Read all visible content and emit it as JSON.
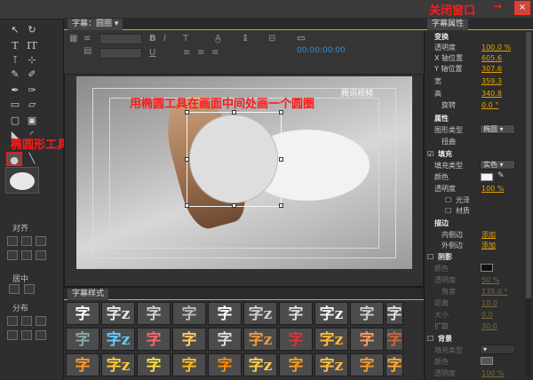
{
  "title_tab": "字幕：圆圈",
  "style_tab": "字幕样式",
  "props_tab": "字幕属性",
  "timecode": "00:00:00:00",
  "annotations": {
    "close_window": "关闭窗口",
    "ellipse_tool": "椭圆形工具",
    "instruction": "用椭圆工具在画面中间处画一个圆圈"
  },
  "left_sections": {
    "align": "对齐",
    "center": "居中",
    "distribute": "分布"
  },
  "logo_text": "腾讯视频",
  "props": {
    "transform": "变换",
    "opacity_label": "透明度",
    "opacity_value": "100.0 %",
    "x_label": "X 轴位置",
    "x_value": "605.6",
    "y_label": "Y 轴位置",
    "y_value": "307.6",
    "width_label": "宽",
    "width_value": "359.3",
    "height_label": "高",
    "height_value": "340.8",
    "rotation_label": "旋转",
    "rotation_value": "0.0 °",
    "attributes": "属性",
    "shape_type_label": "图形类型",
    "shape_type_value": "椭圆",
    "distort_label": "扭曲",
    "fill": "填充",
    "fill_type_label": "填充类型",
    "fill_type_value": "实色",
    "color_label": "颜色",
    "fill_opacity_label": "透明度",
    "fill_opacity_value": "100 %",
    "sheen_label": "光泽",
    "texture_label": "材质",
    "stroke": "描边",
    "inner_stroke_label": "内侧边",
    "inner_stroke_add": "添加",
    "outer_stroke_label": "外侧边",
    "outer_stroke_add": "添加",
    "shadow": "阴影",
    "shadow_color_label": "颜色",
    "shadow_opacity_label": "透明度",
    "shadow_opacity_value": "50 %",
    "angle_label": "角度",
    "angle_value": "135.0 °",
    "distance_label": "距离",
    "distance_value": "10.0",
    "size_label": "大小",
    "size_value": "0.0",
    "spread_label": "扩散",
    "spread_value": "30.0",
    "background": "背景",
    "bg_fill_type_label": "填充类型",
    "bg_color_label": "颜色",
    "bg_opacity_label": "透明度",
    "bg_opacity_value": "100 %"
  },
  "swatch_glyphs": [
    "字",
    "字z",
    "字",
    "字",
    "字",
    "字z",
    "字",
    "字z",
    "字",
    "字"
  ],
  "colors": {
    "accent": "#e6a200",
    "annotation": "#ff1a1a",
    "timecode": "#2f8dd6"
  }
}
